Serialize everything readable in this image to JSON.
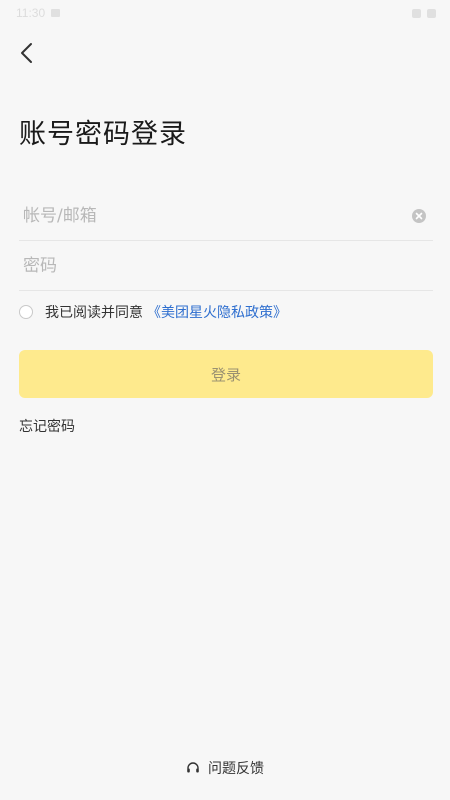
{
  "status_bar": {
    "time": "11:30"
  },
  "header": {
    "back_icon": "chevron-left-icon",
    "title": "账号密码登录"
  },
  "form": {
    "account_placeholder": "帐号/邮箱",
    "account_value": "",
    "password_placeholder": "密码",
    "password_value": "",
    "clear_icon": "clear-circle-icon"
  },
  "agreement": {
    "checked": false,
    "text": "我已阅读并同意",
    "policy_link": "《美团星火隐私政策》"
  },
  "actions": {
    "login_label": "登录",
    "forgot_password": "忘记密码"
  },
  "footer": {
    "feedback_icon": "headset-icon",
    "feedback_label": "问题反馈"
  },
  "colors": {
    "background": "#f7f7f7",
    "login_button": "#feea8d",
    "login_text": "#9a9171",
    "link": "#2f6fcf",
    "placeholder": "#b8b8b8"
  }
}
